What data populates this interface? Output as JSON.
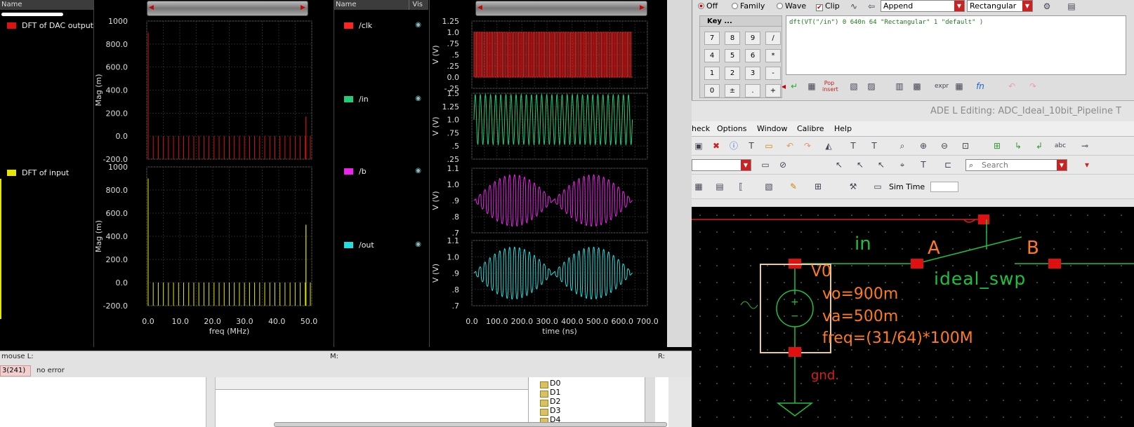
{
  "waveform": {
    "left_legend": {
      "header": "Name",
      "entries": [
        {
          "label": "DFT of DAC output",
          "color": "#dd1111"
        },
        {
          "label": "DFT of input",
          "color": "#e6e600"
        }
      ]
    },
    "right_legend": {
      "header_name": "Name",
      "header_vis": "Vis",
      "entries": [
        {
          "label": "/clk",
          "color": "#ff2222"
        },
        {
          "label": "/in",
          "color": "#22cc77"
        },
        {
          "label": "/b",
          "color": "#ee22ee"
        },
        {
          "label": "/out",
          "color": "#22dddd"
        }
      ]
    },
    "dft_plots": {
      "y_label": "Mag (m)",
      "y_ticks": [
        "1000",
        "800.0",
        "600.0",
        "400.0",
        "200.0",
        "0.0",
        "-200.0"
      ],
      "x_ticks": [
        "0.0",
        "10.0",
        "20.0",
        "30.0",
        "40.0",
        "50.0"
      ],
      "x_label": "freq (MHz)"
    },
    "time_plots": {
      "y_label": "V (V)",
      "clk_ticks": [
        "1.25",
        "1.0",
        ".75",
        ".5",
        ".25",
        "0.0",
        "-.25"
      ],
      "in_ticks": [
        "1.5",
        "1.25",
        "1.0",
        ".75",
        ".5",
        ".25"
      ],
      "b_ticks": [
        "1.1",
        "1.0",
        ".9",
        ".8",
        ".7"
      ],
      "out_ticks": [
        "1.1",
        "1.0",
        ".9",
        ".8",
        ".7"
      ],
      "x_ticks": [
        "0.0",
        "100.0",
        "200.0",
        "300.0",
        "400.0",
        "500.0",
        "600.0",
        "700.0"
      ],
      "x_label": "time (ns)"
    },
    "status": {
      "mouse_l": "mouse L:",
      "mouse_m": "M:",
      "mouse_r": "R:",
      "code": "3(241)",
      "message": "no error"
    }
  },
  "calculator": {
    "options": {
      "off": "Off",
      "family": "Family",
      "wave": "Wave",
      "clip": "Clip"
    },
    "mode_dropdown": "Append",
    "window_dropdown": "Rectangular",
    "keypad_title": "Key ...",
    "keys": [
      "7",
      "8",
      "9",
      "/",
      "4",
      "5",
      "6",
      "*",
      "1",
      "2",
      "3",
      "-",
      "0",
      "±",
      ".",
      "+"
    ],
    "expression": "dft(VT(\"/in\") 0 640n 64 \"Rectangular\" 1 \"default\" )",
    "icon_labels": {
      "pop_insert": "Pop insert",
      "expr": "expr",
      "fn": "fn"
    }
  },
  "ade": {
    "title": "ADE L Editing: ADC_Ideal_10bit_Pipeline T",
    "menu": [
      "heck",
      "Options",
      "Window",
      "Calibre",
      "Help"
    ],
    "search_placeholder": "Search",
    "sim_time_label": "Sim Time"
  },
  "schematic": {
    "net_in": "in",
    "pin_a": "A",
    "pin_b": "B",
    "switch_name": "ideal_swp",
    "source_name": "V0",
    "vo": "vo=900m",
    "va": "va=500m",
    "freq": "freq=(31/64)*100M",
    "gnd": "gnd."
  },
  "tree": {
    "items": [
      "D0",
      "D1",
      "D2",
      "D3",
      "D4"
    ]
  },
  "colors": {
    "dac_output": "#dd1111",
    "input_dft": "#e6e600",
    "clk": "#ff2222",
    "in": "#22cc77",
    "b": "#ee22ee",
    "out": "#22dddd",
    "schematic_green": "#1fbf3f",
    "schematic_orange": "#ff7a1a"
  }
}
